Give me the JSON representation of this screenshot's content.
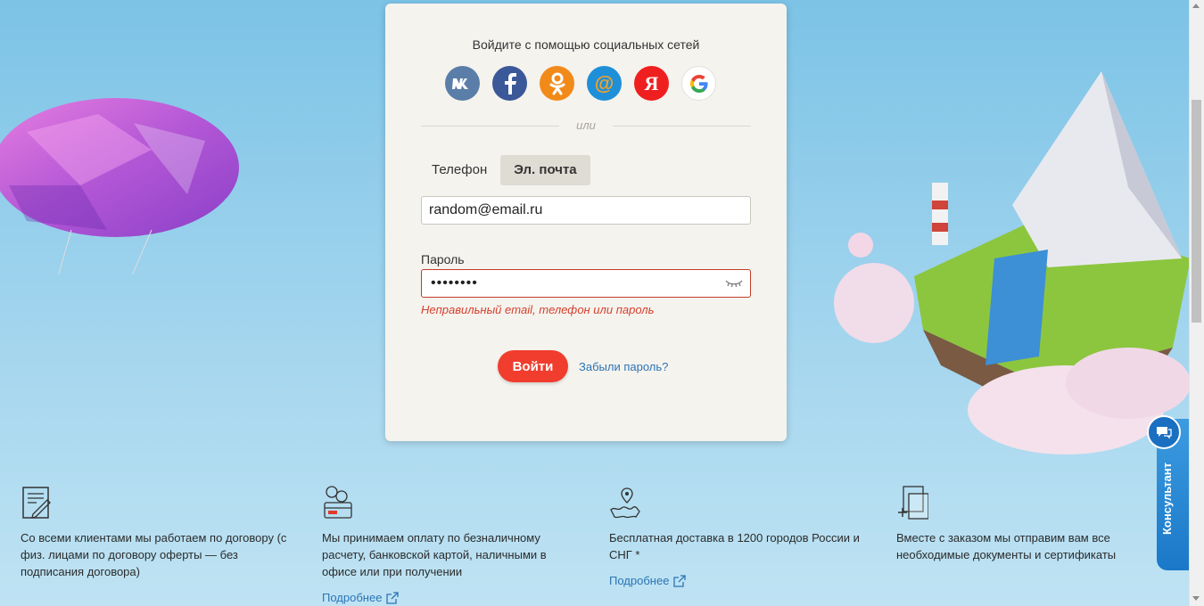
{
  "login": {
    "social_title": "Войдите с помощью социальных сетей",
    "socials": [
      {
        "icon": "vk-icon",
        "color": "#5a7ea8"
      },
      {
        "icon": "facebook-icon",
        "color": "#3b5998"
      },
      {
        "icon": "odnoklassniki-icon",
        "color": "#f28a1a"
      },
      {
        "icon": "mailru-icon",
        "color": "#1f8fd8"
      },
      {
        "icon": "yandex-icon",
        "color": "#f01f1f"
      },
      {
        "icon": "google-icon",
        "color": "#ffffff"
      }
    ],
    "divider_text": "или",
    "tabs": {
      "phone": "Телефон",
      "email": "Эл. почта",
      "active": "email"
    },
    "email_value": "random@email.ru",
    "password_label": "Пароль",
    "password_value": "password",
    "error_text": "Неправильный email, телефон или пароль",
    "login_button": "Войти",
    "forgot_link": "Забыли пароль?"
  },
  "features": [
    {
      "icon": "contract-icon",
      "text": "Со всеми клиентами мы работаем по договору (с физ. лицами по договору оферты — без подписания договора)",
      "more": ""
    },
    {
      "icon": "payment-icon",
      "text": "Мы принимаем оплату по безналичному расчету, банковской картой, наличными в офисе или при получении",
      "more": "Подробнее"
    },
    {
      "icon": "delivery-map-icon",
      "text": "Бесплатная доставка в 1200 городов России и СНГ *",
      "more": "Подробнее"
    },
    {
      "icon": "documents-icon",
      "text": "Вместе с заказом мы отправим вам все необходимые документы и сертификаты",
      "more": ""
    }
  ],
  "consultant": {
    "label": "Консультант",
    "color": "#1a78c8"
  },
  "colors": {
    "accent_red": "#f03d2e",
    "link_blue": "#2b74b5",
    "error_red": "#d6402e",
    "card_bg": "#f5f3ee"
  }
}
